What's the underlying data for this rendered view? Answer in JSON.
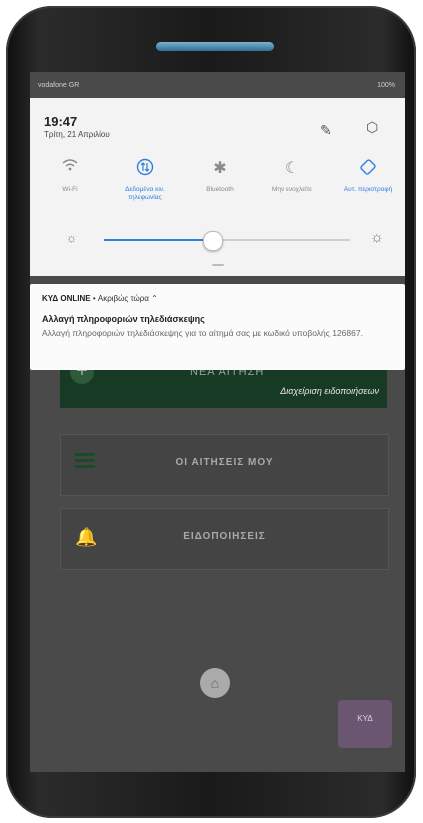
{
  "status_bar": {
    "carrier": "vodafone GR",
    "right": "100%"
  },
  "shade": {
    "time": "19:47",
    "date": "Τρίτη, 21 Απριλίου",
    "icons": {
      "edit": "pencil-icon",
      "settings": "hexagon-settings-icon"
    },
    "tiles": [
      {
        "label": "Wi-Fi",
        "icon": "wifi-icon",
        "active": false
      },
      {
        "label": "Δεδομένα κιν. τηλεφωνίας",
        "icon": "mobile-data-icon",
        "active": true
      },
      {
        "label": "Bluetooth",
        "icon": "bluetooth-icon",
        "active": false
      },
      {
        "label": "Μην ενοχλείτε",
        "icon": "moon-icon",
        "active": false
      },
      {
        "label": "Αυτ. περιστροφή",
        "icon": "auto-rotate-icon",
        "active": true
      }
    ],
    "brightness": {
      "level": 0.44
    }
  },
  "notification": {
    "app": "ΚΥΔ ONLINE",
    "time": "Ακριβώς τώρα",
    "title": "Αλλαγή πληροφοριών τηλεδιάσκεψης",
    "body": "Αλλαγή πληροφοριών τηλεδιάσκεψης για το αίτημά σας με κωδικό υποβολής 126867."
  },
  "app": {
    "new_request": "ΝΕΑ ΑΙΤΗΣΗ",
    "manage_notifications": "Διαχείριση ειδοποιήσεων",
    "my_requests": "ΟΙ ΑΙΤΗΣΕΙΣ ΜΟΥ",
    "notifications": "ΕΙΔΟΠΟΙΗΣΕΙΣ",
    "logo_text": "ΚΥΔ"
  },
  "colors": {
    "accent": "#2f7fe0",
    "app_green": "#173a25"
  }
}
